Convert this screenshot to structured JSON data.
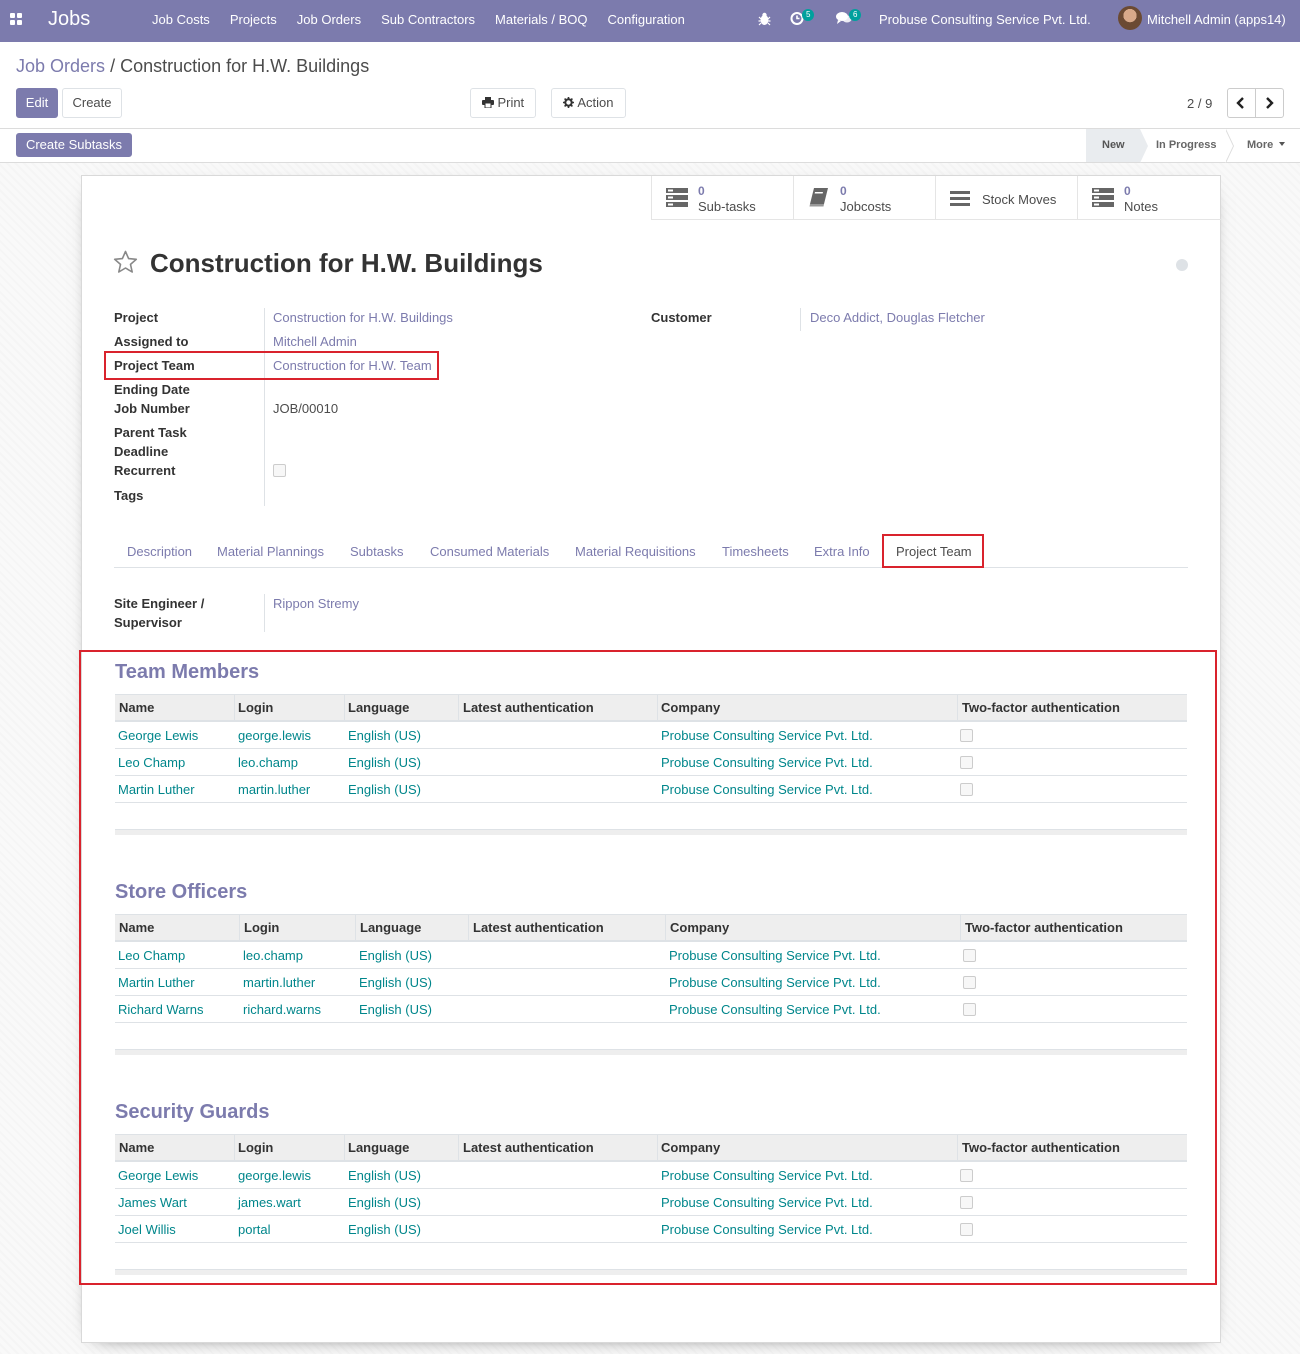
{
  "navbar": {
    "brand": "Jobs",
    "menu": [
      "Job Costs",
      "Projects",
      "Job Orders",
      "Sub Contractors",
      "Materials / BOQ",
      "Configuration"
    ],
    "activity_count": "5",
    "message_count": "6",
    "company": "Probuse Consulting Service Pvt. Ltd.",
    "user": "Mitchell Admin (apps14)"
  },
  "breadcrumb": {
    "parent": "Job Orders",
    "separator": "/",
    "current": "Construction for H.W. Buildings"
  },
  "buttons": {
    "edit": "Edit",
    "create": "Create",
    "print": "Print",
    "action": "Action",
    "create_subtasks": "Create Subtasks"
  },
  "pager": {
    "value": "2 / 9"
  },
  "stages": {
    "new": "New",
    "in_progress": "In Progress",
    "more": "More"
  },
  "smart_buttons": {
    "subtasks": {
      "value": "0",
      "label": "Sub-tasks"
    },
    "jobcosts": {
      "value": "0",
      "label": "Jobcosts"
    },
    "stock_moves": {
      "label": "Stock Moves"
    },
    "notes": {
      "value": "0",
      "label": "Notes"
    }
  },
  "record": {
    "title": "Construction for H.W. Buildings",
    "fields": {
      "project_label": "Project",
      "project": "Construction for H.W. Buildings",
      "assigned_label": "Assigned to",
      "assigned": "Mitchell Admin",
      "team_label": "Project Team",
      "team": "Construction for H.W. Team",
      "ending_label": "Ending Date",
      "jobnum_label": "Job Number",
      "jobnum": "JOB/00010",
      "parent_label": "Parent Task",
      "deadline_label": "Deadline",
      "recurrent_label": "Recurrent",
      "tags_label": "Tags",
      "customer_label": "Customer",
      "customer": "Deco Addict, Douglas Fletcher"
    }
  },
  "tabs": [
    "Description",
    "Material Plannings",
    "Subtasks",
    "Consumed Materials",
    "Material Requisitions",
    "Timesheets",
    "Extra Info",
    "Project Team"
  ],
  "project_team": {
    "supervisor_label_1": "Site Engineer /",
    "supervisor_label_2": "Supervisor",
    "supervisor": "Rippon Stremy"
  },
  "columns": [
    "Name",
    "Login",
    "Language",
    "Latest authentication",
    "Company",
    "Two-factor authentication"
  ],
  "team_members": {
    "title": "Team Members",
    "rows": [
      {
        "name": "George Lewis",
        "login": "george.lewis",
        "language": "English (US)",
        "company": "Probuse Consulting Service Pvt. Ltd."
      },
      {
        "name": "Leo Champ",
        "login": "leo.champ",
        "language": "English (US)",
        "company": "Probuse Consulting Service Pvt. Ltd."
      },
      {
        "name": "Martin Luther",
        "login": "martin.luther",
        "language": "English (US)",
        "company": "Probuse Consulting Service Pvt. Ltd."
      }
    ]
  },
  "store_officers": {
    "title": "Store Officers",
    "rows": [
      {
        "name": "Leo Champ",
        "login": "leo.champ",
        "language": "English (US)",
        "company": "Probuse Consulting Service Pvt. Ltd."
      },
      {
        "name": "Martin Luther",
        "login": "martin.luther",
        "language": "English (US)",
        "company": "Probuse Consulting Service Pvt. Ltd."
      },
      {
        "name": "Richard Warns",
        "login": "richard.warns",
        "language": "English (US)",
        "company": "Probuse Consulting Service Pvt. Ltd."
      }
    ]
  },
  "security_guards": {
    "title": "Security Guards",
    "rows": [
      {
        "name": "George Lewis",
        "login": "george.lewis",
        "language": "English (US)",
        "company": "Probuse Consulting Service Pvt. Ltd."
      },
      {
        "name": "James Wart",
        "login": "james.wart",
        "language": "English (US)",
        "company": "Probuse Consulting Service Pvt. Ltd."
      },
      {
        "name": "Joel Willis",
        "login": "portal",
        "language": "English (US)",
        "company": "Probuse Consulting Service Pvt. Ltd."
      }
    ]
  },
  "colors": {
    "brand": "#7c7bad",
    "link": "#00868b",
    "highlight": "#d9232d"
  }
}
